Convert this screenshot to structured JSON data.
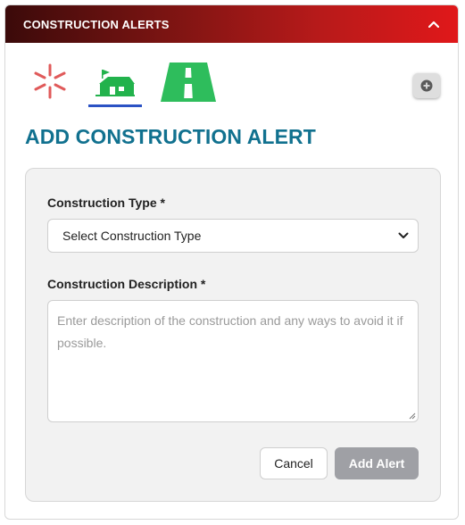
{
  "header": {
    "title": "CONSTRUCTION ALERTS",
    "collapse_icon": "chevron-up-icon"
  },
  "tabs": [
    {
      "name": "incident",
      "icon": "sparkle-icon",
      "color": "#e05a5a",
      "active": false
    },
    {
      "name": "construction",
      "icon": "construction-house-icon",
      "color": "#22b24c",
      "active": true
    },
    {
      "name": "road",
      "icon": "road-icon",
      "color": "#2ebd5c",
      "active": false
    }
  ],
  "add_button_icon": "plus-circle-icon",
  "page_title": "ADD CONSTRUCTION ALERT",
  "form": {
    "type_label": "Construction Type *",
    "type_selected": "Select Construction Type",
    "description_label": "Construction Description *",
    "description_placeholder": "Enter description of the construction and any ways to avoid it if possible.",
    "cancel_label": "Cancel",
    "submit_label": "Add Alert"
  },
  "colors": {
    "title": "#11718f",
    "header_start": "#3b0a0a",
    "header_end": "#e0181a",
    "active_underline": "#2b52c4",
    "disabled_button": "#9fa0a5"
  }
}
